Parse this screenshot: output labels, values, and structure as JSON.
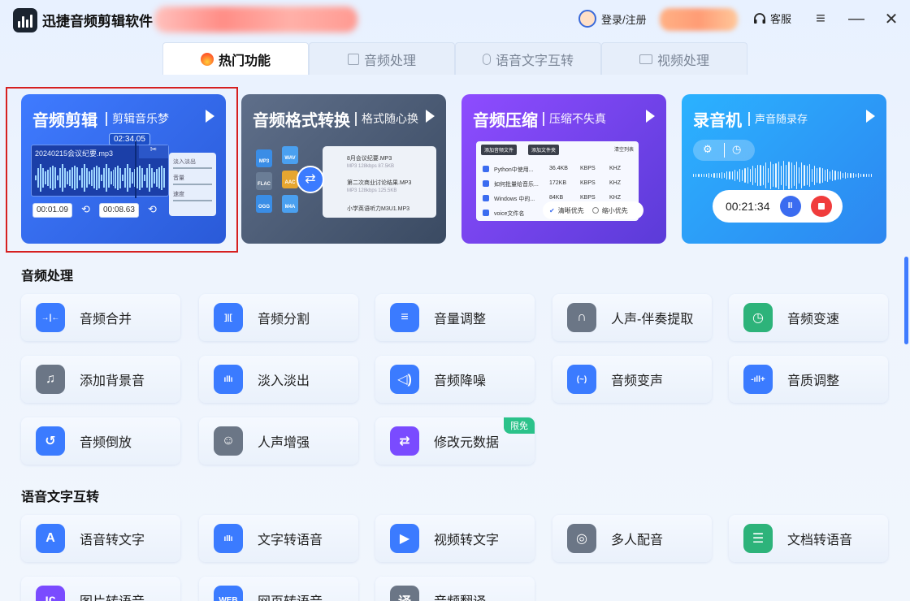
{
  "app": {
    "title": "迅捷音频剪辑软件",
    "login_label": "登录/注册",
    "service_label": "客服"
  },
  "tabs": [
    {
      "label": "热门功能",
      "icon": "flame-icon",
      "active": true
    },
    {
      "label": "音频处理",
      "icon": "audio-file-icon",
      "active": false
    },
    {
      "label": "语音文字互转",
      "icon": "microphone-icon",
      "active": false
    },
    {
      "label": "视频处理",
      "icon": "video-icon",
      "active": false
    }
  ],
  "cards": {
    "edit": {
      "title": "音频剪辑",
      "subtitle": "剪辑音乐梦",
      "time_badge": "02:34.05",
      "file_name": "20240215会议纪要.mp3",
      "knob_labels": [
        "淡入淡出",
        "音量",
        "速度"
      ],
      "start_time": "00:01.09",
      "end_time": "00:08.63"
    },
    "convert": {
      "title": "音频格式转换",
      "subtitle": "格式随心换",
      "formats": [
        "MP3",
        "WAV",
        "FLAC",
        "AAC",
        "OGG",
        "M4A"
      ],
      "files": [
        {
          "name": "8月会议纪要.MP3",
          "meta": "MP3   128kbps   87.5KB"
        },
        {
          "name": "第二次商业讨论结果.MP3",
          "meta": "MP3   128kbps   125.5KB"
        },
        {
          "name": "小学英语听力M3U1.MP3",
          "meta": ""
        }
      ]
    },
    "compress": {
      "title": "音频压缩",
      "subtitle": "压缩不失真",
      "btn_add_file": "添加音频文件",
      "btn_add_folder": "添加文件夹",
      "btn_clear": "清空列表",
      "rows": [
        {
          "name": "Python中使用...",
          "size": "36.4KB",
          "rate": "KBPS",
          "freq": "KHZ"
        },
        {
          "name": "如何批量给音乐...",
          "size": "172KB",
          "rate": "KBPS",
          "freq": "KHZ"
        },
        {
          "name": "Windows 中的...",
          "size": "84KB",
          "rate": "KBPS",
          "freq": "KHZ"
        },
        {
          "name": "voice文件名",
          "size": "",
          "rate": "",
          "freq": ""
        }
      ],
      "opt_clear": "清晰优先",
      "opt_small": "缩小优先"
    },
    "record": {
      "title": "录音机",
      "subtitle": "声音随录存",
      "timer": "00:21:34",
      "pause_label": "II"
    }
  },
  "sections": {
    "audio": {
      "title": "音频处理",
      "items": [
        {
          "label": "音频合并",
          "icon": "merge-icon",
          "color": "#3b7bff",
          "glyph": "→|←"
        },
        {
          "label": "音频分割",
          "icon": "split-icon",
          "color": "#3b7bff",
          "glyph": "]|["
        },
        {
          "label": "音量调整",
          "icon": "sliders-icon",
          "color": "#3b7bff",
          "glyph": "≡"
        },
        {
          "label": "人声-伴奏提取",
          "icon": "headphones-icon",
          "color": "#6b7686",
          "glyph": "∩"
        },
        {
          "label": "音频变速",
          "icon": "speed-icon",
          "color": "#2db37a",
          "glyph": "◷"
        },
        {
          "label": "添加背景音",
          "icon": "music-note-icon",
          "color": "#6b7686",
          "glyph": "♫"
        },
        {
          "label": "淡入淡出",
          "icon": "fade-bars-icon",
          "color": "#3b7bff",
          "glyph": "ıllı"
        },
        {
          "label": "音频降噪",
          "icon": "speaker-icon",
          "color": "#3b7bff",
          "glyph": "◁)"
        },
        {
          "label": "音频变声",
          "icon": "voice-change-icon",
          "color": "#3b7bff",
          "glyph": "(~)"
        },
        {
          "label": "音质调整",
          "icon": "quality-bars-icon",
          "color": "#3b7bff",
          "glyph": "-ıll+"
        },
        {
          "label": "音频倒放",
          "icon": "reverse-icon",
          "color": "#3b7bff",
          "glyph": "↺"
        },
        {
          "label": "人声增强",
          "icon": "person-voice-icon",
          "color": "#6b7686",
          "glyph": "☺"
        },
        {
          "label": "修改元数据",
          "icon": "metadata-icon",
          "color": "#7a4bff",
          "glyph": "⇄",
          "badge": "限免"
        }
      ]
    },
    "speech": {
      "title": "语音文字互转",
      "items": [
        {
          "label": "语音转文字",
          "icon": "letter-a-icon",
          "color": "#3b7bff",
          "glyph": "A"
        },
        {
          "label": "文字转语音",
          "icon": "sound-wave-icon",
          "color": "#3b7bff",
          "glyph": "ıIIı"
        },
        {
          "label": "视频转文字",
          "icon": "play-circle-icon",
          "color": "#3b7bff",
          "glyph": "▶"
        },
        {
          "label": "多人配音",
          "icon": "mic-ring-icon",
          "color": "#6b7686",
          "glyph": "◎"
        },
        {
          "label": "文档转语音",
          "icon": "document-lines-icon",
          "color": "#2db37a",
          "glyph": "☰"
        },
        {
          "label": "图片转语音",
          "icon": "image-icon",
          "color": "#7a4bff",
          "glyph": "ıc"
        },
        {
          "label": "网页转语音",
          "icon": "web-icon",
          "color": "#3b7bff",
          "glyph": "WEB"
        },
        {
          "label": "音频翻译",
          "icon": "translate-icon",
          "color": "#6b7686",
          "glyph": "译"
        }
      ]
    }
  }
}
